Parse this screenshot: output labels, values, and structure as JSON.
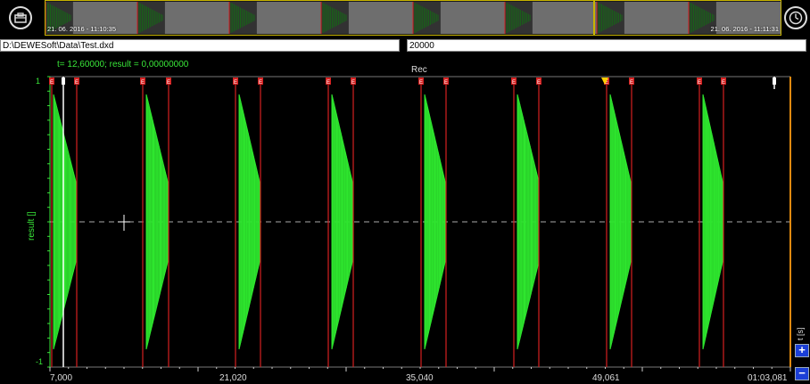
{
  "overview": {
    "start_timestamp": "21. 06. 2016 - 11:10:35",
    "end_timestamp": "21. 06. 2016 - 11:11:31",
    "segments": 8
  },
  "file_path": "D:\\DEWESoft\\Data\\Test.dxd",
  "sample_count": "20000",
  "cursor_readout": "t= 12,60000; result = 0,00000000",
  "recorder_title": "Rec",
  "y_axis": {
    "label": "result []",
    "max_label": "1",
    "min_label": "-1"
  },
  "x_axis": {
    "unit_label": "t [s]",
    "ticks": [
      "7,000",
      "21,020",
      "35,040",
      "49,061",
      "01:03,081"
    ]
  },
  "event_marker_glyph": "E",
  "icons": {
    "left": "toolbox-icon",
    "right": "clock-icon"
  },
  "colors": {
    "signal": "#2ee62e",
    "marker": "#d42020",
    "cursor": "#ffffff",
    "overview_border": "#c8b400"
  },
  "zoom": {
    "plus": "+",
    "minus": "−"
  }
}
